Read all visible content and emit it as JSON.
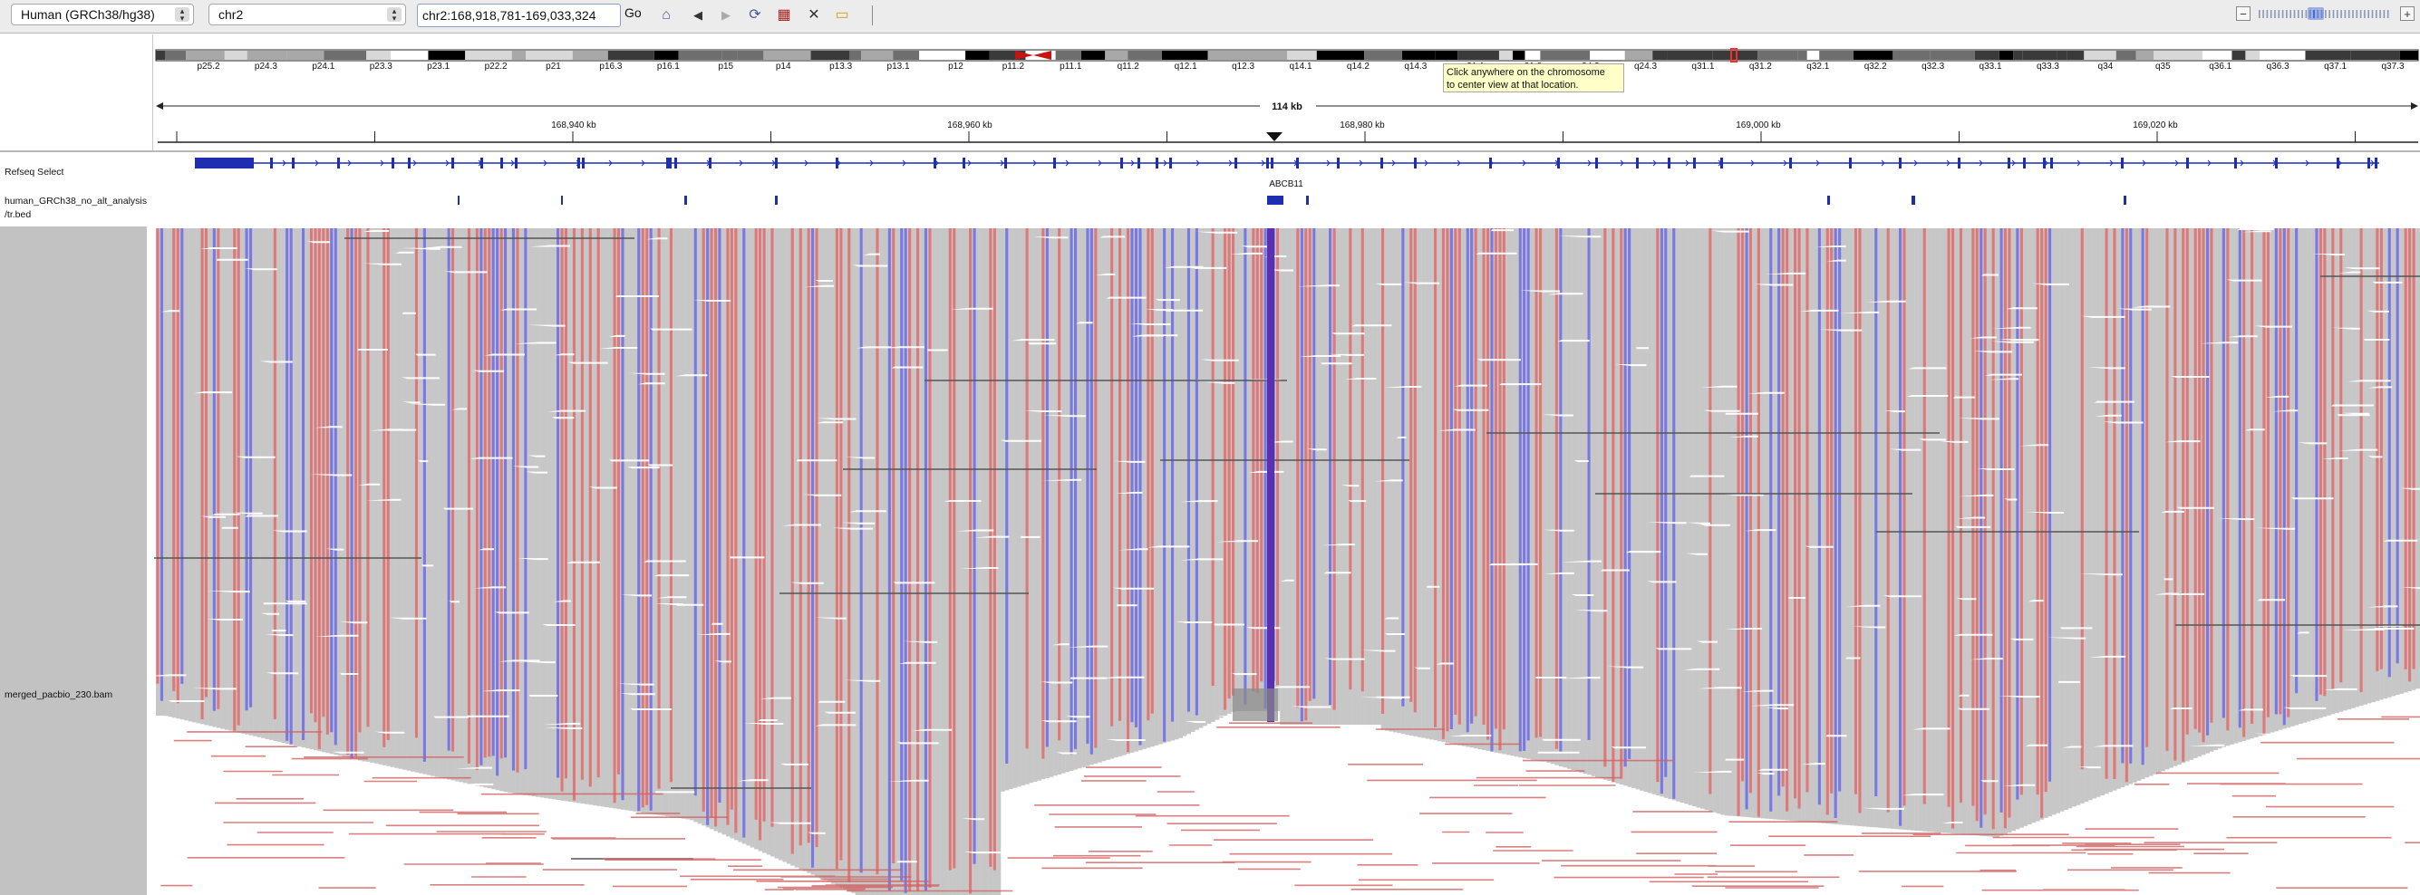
{
  "toolbar": {
    "genome": "Human (GRCh38/hg38)",
    "chromosome": "chr2",
    "locus": "chr2:168,918,781-169,033,324",
    "go_label": "Go",
    "icons": [
      "home-icon",
      "back-arrow-icon",
      "forward-arrow-icon",
      "refresh-icon",
      "region-of-interest-icon",
      "resize-icon",
      "popup-text-icon"
    ],
    "zoom_minus": "−",
    "zoom_plus": "+"
  },
  "ideogram": {
    "bands": [
      "p25.2",
      "p24.3",
      "p24.1",
      "p23.3",
      "p23.1",
      "p22.2",
      "p21",
      "p16.3",
      "p16.1",
      "p15",
      "p14",
      "p13.3",
      "p13.1",
      "p12",
      "p11.2",
      "p11.1",
      "q11.2",
      "q12.1",
      "q12.3",
      "q14.1",
      "q14.2",
      "q14.3",
      "q21.1",
      "q21.3",
      "q24.2",
      "q24.3",
      "q31.1",
      "q31.2",
      "q32.1",
      "q32.2",
      "q32.3",
      "q33.1",
      "q33.3",
      "q34",
      "q35",
      "q36.1",
      "q36.3",
      "q37.1",
      "q37.3"
    ]
  },
  "tooltip": {
    "line1": "Click anywhere on the chromosome",
    "line2": "to center view at that location."
  },
  "ruler": {
    "span": "114 kb",
    "ticks": [
      "168,940 kb",
      "168,960 kb",
      "168,980 kb",
      "169,000 kb",
      "169,020 kb"
    ]
  },
  "tracks": {
    "refseq": "Refseq Select",
    "bed_line1": "human_GRCh38_no_alt_analysis",
    "bed_line2": "/tr.bed",
    "bam": "merged_pacbio_230.bam"
  },
  "gene": {
    "name": "ABCB11"
  },
  "colors": {
    "read_gray": "#c7c7c7",
    "mismatch_red": "#e07070",
    "mismatch_blue": "#6b6bea",
    "gene_blue": "#1d2fb0",
    "centromere": "#cc1111"
  }
}
